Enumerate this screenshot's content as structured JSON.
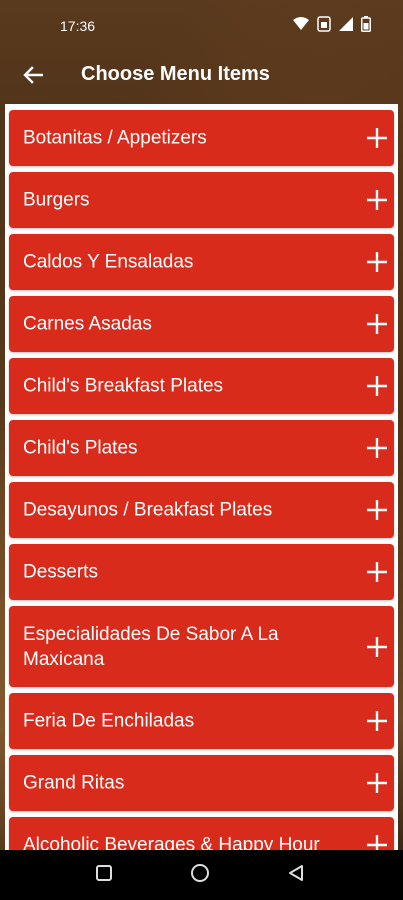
{
  "status_bar": {
    "time": "17:36",
    "icons": [
      "wifi-icon",
      "sim-icon",
      "signal-icon",
      "battery-icon"
    ]
  },
  "header": {
    "title": "Choose Menu Items",
    "back_icon": "arrow-left-icon"
  },
  "colors": {
    "item_bg": "#d92b1c",
    "list_bg": "#ffffff",
    "text": "#ffffff"
  },
  "menu_items": [
    {
      "label": "Botanitas / Appetizers"
    },
    {
      "label": "Burgers"
    },
    {
      "label": "Caldos Y Ensaladas"
    },
    {
      "label": "Carnes Asadas"
    },
    {
      "label": "Child's Breakfast Plates"
    },
    {
      "label": "Child's Plates"
    },
    {
      "label": "Desayunos / Breakfast Plates"
    },
    {
      "label": "Desserts"
    },
    {
      "label": "Especialidades De Sabor A La Maxicana"
    },
    {
      "label": "Feria De Enchiladas"
    },
    {
      "label": "Grand Ritas"
    },
    {
      "label": "Alcoholic Beverages & Happy Hour"
    }
  ],
  "nav_bar": {
    "buttons": [
      "recents-square-icon",
      "home-circle-icon",
      "back-triangle-icon"
    ]
  }
}
